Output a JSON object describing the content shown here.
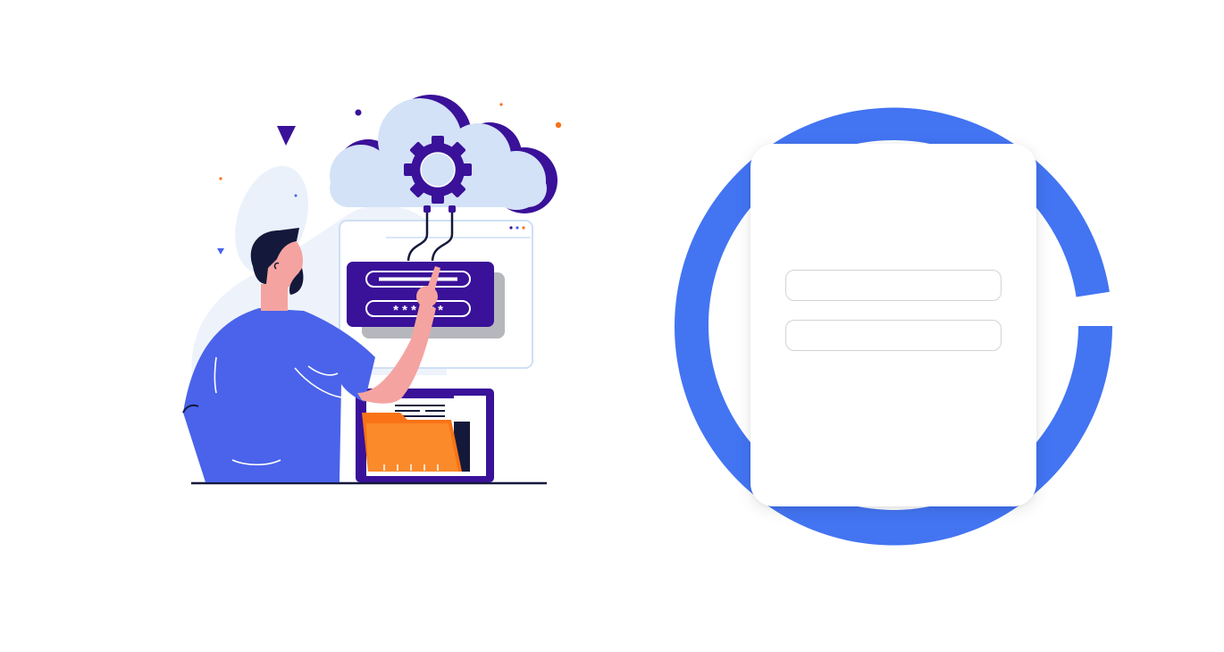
{
  "illustration": {
    "password_mask": "* * * * * *",
    "colors": {
      "primary_purple": "#3a1199",
      "accent_blue": "#4a63ea",
      "cloud": "#d3e2f7",
      "orange": "#f97316",
      "skin": "#f5a3a0",
      "hair": "#14193b"
    }
  },
  "login": {
    "username_value": "",
    "username_placeholder": "",
    "password_value": "",
    "password_placeholder": ""
  },
  "theme": {
    "ring_color": "#4374f2",
    "card_background": "#ffffff",
    "field_border": "#d4d4d4"
  }
}
